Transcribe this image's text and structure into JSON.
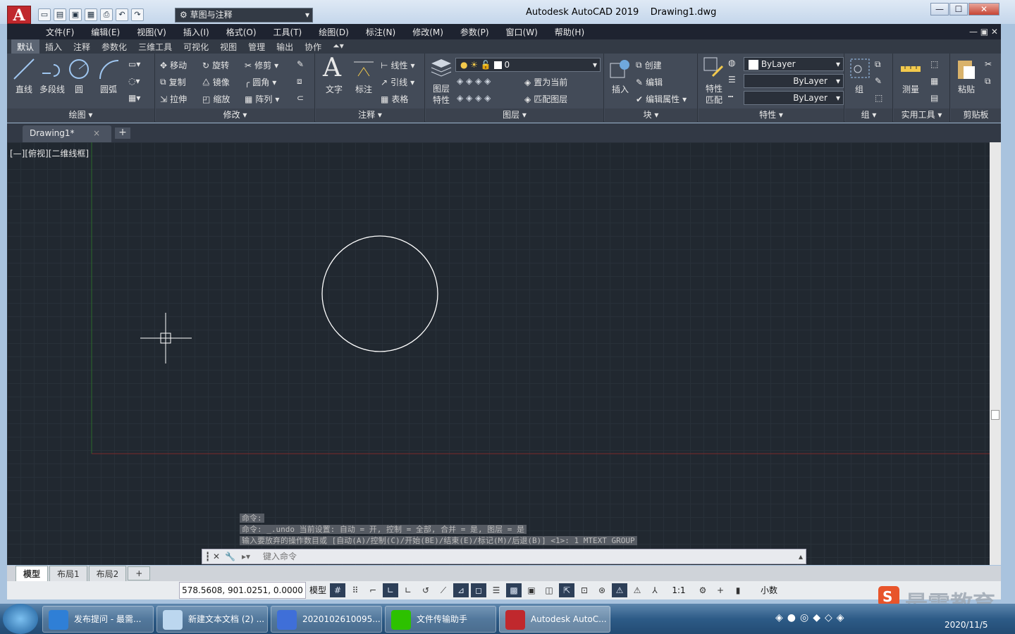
{
  "title_bar": {
    "app_title": "Autodesk AutoCAD 2019",
    "file_name": "Drawing1.dwg",
    "workspace": "草图与注释",
    "logo_letter": "A"
  },
  "menu": [
    "文件(F)",
    "编辑(E)",
    "视图(V)",
    "插入(I)",
    "格式(O)",
    "工具(T)",
    "绘图(D)",
    "标注(N)",
    "修改(M)",
    "参数(P)",
    "窗口(W)",
    "帮助(H)"
  ],
  "ribbon_tabs": [
    "默认",
    "插入",
    "注释",
    "参数化",
    "三维工具",
    "可视化",
    "视图",
    "管理",
    "输出",
    "协作"
  ],
  "panels": {
    "draw": {
      "title": "绘图",
      "line": "直线",
      "polyline": "多段线",
      "circle": "圆",
      "arc": "圆弧"
    },
    "modify": {
      "title": "修改",
      "move": "移动",
      "rotate": "旋转",
      "trim": "修剪",
      "copy": "复制",
      "mirror": "镜像",
      "fillet": "圆角",
      "stretch": "拉伸",
      "scale": "缩放",
      "array": "阵列"
    },
    "annotation": {
      "title": "注释",
      "text": "文字",
      "dimension": "标注",
      "linear": "线性",
      "leader": "引线",
      "table": "表格"
    },
    "layers": {
      "title": "图层",
      "layer_props_1": "图层",
      "layer_props_2": "特性",
      "current_layer": "0",
      "make_current": "置为当前",
      "match_layer": "匹配图层"
    },
    "block": {
      "title": "块",
      "insert": "插入",
      "create": "创建",
      "edit": "编辑",
      "edit_attr": "编辑属性"
    },
    "properties": {
      "title": "特性",
      "match_1": "特性",
      "match_2": "匹配",
      "color": "ByLayer",
      "linetype": "ByLayer",
      "lineweight": "ByLayer"
    },
    "groups": {
      "title": "组",
      "group": "组"
    },
    "utilities": {
      "title": "实用工具",
      "measure": "测量"
    },
    "clipboard": {
      "title": "剪贴板",
      "paste": "粘贴"
    }
  },
  "file_tab": {
    "name": "Drawing1*",
    "close": "×",
    "add": "+"
  },
  "viewport_label": "[—][俯视][二维线框]",
  "command_log": [
    "命令:",
    "命令: _.undo 当前设置: 自动 = 开, 控制 = 全部, 合并 = 是, 图层 = 是",
    "输入要放弃的操作数目或 [自动(A)/控制(C)/开始(BE)/结束(E)/标记(M)/后退(B)] <1>: 1 MTEXT GROUP"
  ],
  "command_input": {
    "placeholder": "键入命令"
  },
  "layout_tabs": [
    "模型",
    "布局1",
    "布局2"
  ],
  "layout_add": "+",
  "status": {
    "coords": "578.5608, 901.0251, 0.0000",
    "model": "模型",
    "scale": "1:1",
    "units": "小数"
  },
  "taskbar": {
    "items": [
      "发布提问 - 最需...",
      "新建文本文档 (2) ...",
      "2020102610095...",
      "文件传输助手",
      "Autodesk AutoC..."
    ],
    "date": "2020/11/5"
  },
  "watermark": "最需教育",
  "colors": {
    "canvas_bg": "#212830",
    "circle": "#ffffff",
    "x_axis": "#7a2a2a",
    "y_axis": "#2a6a2a",
    "accent": "#c0282d"
  }
}
